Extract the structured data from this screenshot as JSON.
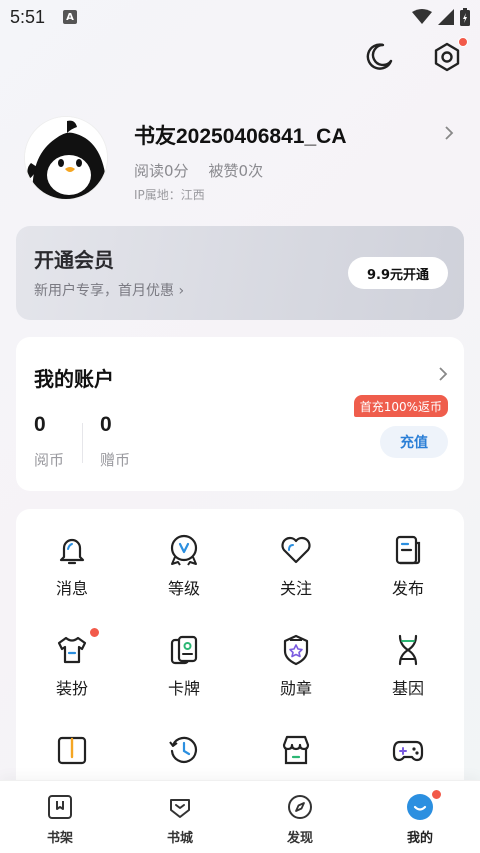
{
  "status_bar": {
    "time": "5:51",
    "notification_icon": "A"
  },
  "top_actions": {
    "night_mode_icon": "moon-icon",
    "settings_icon": "hexagon-settings-icon"
  },
  "profile": {
    "username": "书友20250406841_CA",
    "reads": "阅读0分",
    "likes": "被赞0次",
    "ip_location": "IP属地：江西"
  },
  "vip": {
    "title": "开通会员",
    "subtitle": "新用户专享，首月优惠 ›",
    "button": "9.9元开通"
  },
  "account": {
    "title": "我的账户",
    "coins_value": "0",
    "coins_label": "阅币",
    "gift_value": "0",
    "gift_label": "赠币",
    "promo": "首充100%返币",
    "recharge": "充值"
  },
  "grid": {
    "items": [
      {
        "label": "消息"
      },
      {
        "label": "等级"
      },
      {
        "label": "关注"
      },
      {
        "label": "发布"
      },
      {
        "label": "装扮"
      },
      {
        "label": "卡牌"
      },
      {
        "label": "勋章"
      },
      {
        "label": "基因"
      },
      {
        "label": "阅读故事"
      },
      {
        "label": "浏览历史"
      },
      {
        "label": "周边商城"
      },
      {
        "label": "游戏中心"
      }
    ]
  },
  "bottom_nav": {
    "items": [
      {
        "label": "书架"
      },
      {
        "label": "书城"
      },
      {
        "label": "发现"
      },
      {
        "label": "我的"
      }
    ]
  },
  "colors": {
    "accent_blue": "#2b8fe0",
    "badge_red": "#f25a4a",
    "promo_red": "#ef5d4c"
  }
}
